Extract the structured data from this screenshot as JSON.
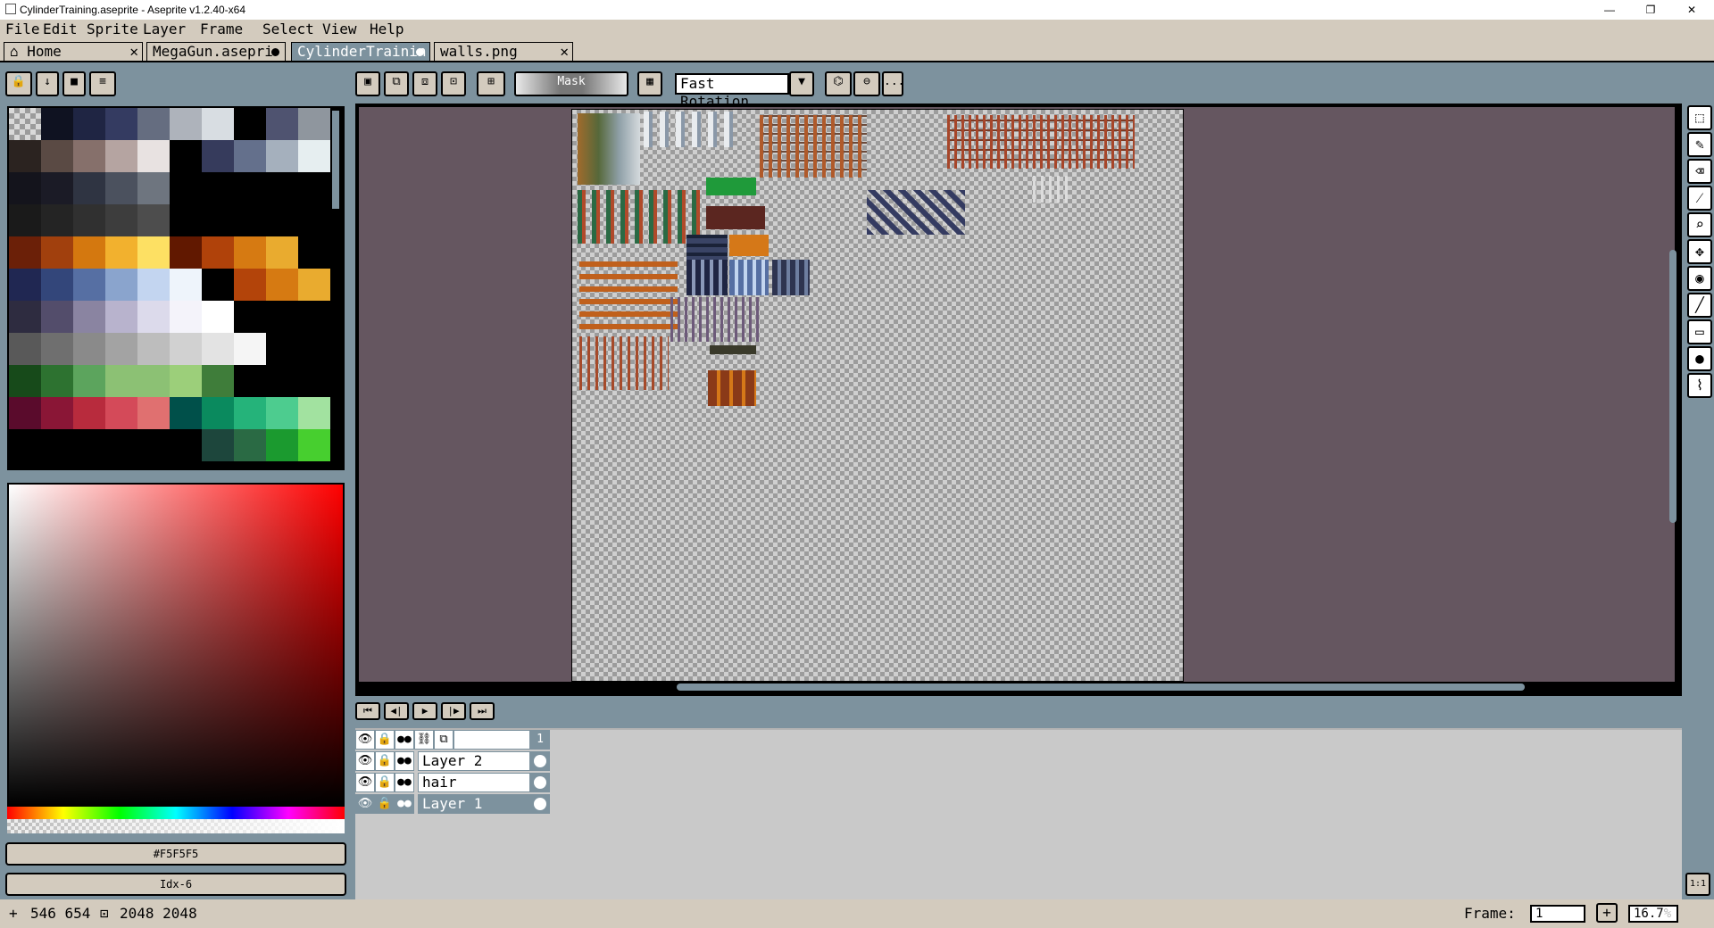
{
  "window": {
    "title": "CylinderTraining.aseprite - Aseprite v1.2.40-x64",
    "minimize": "—",
    "maximize": "❐",
    "close": "✕"
  },
  "menu": [
    "File",
    "Edit",
    "Sprite",
    "Layer",
    "Frame",
    "Select",
    "View",
    "Help"
  ],
  "tabs": [
    {
      "label": "Home",
      "marker": "✕"
    },
    {
      "label": "MegaGun.asepri",
      "marker": "dot"
    },
    {
      "label": "CylinderTrainin",
      "marker": "dot"
    },
    {
      "label": "walls.png",
      "marker": "✕"
    }
  ],
  "context_bar": {
    "mask_label": "Mask",
    "rotation_algorithm": "Fast Rotation",
    "more": "..."
  },
  "palette": {
    "rows": [
      [
        "checker",
        "#0f1221",
        "#1f2543",
        "#343b61",
        "#656d80",
        "#aeb3bb",
        "#d8dde2",
        "#000000",
        "#4f5370",
        "#8f969e"
      ],
      [
        "#2b2320",
        "#5a4a44",
        "#86706b",
        "#b5a4a1",
        "#e8e2e1",
        "#000000",
        "#363b5c",
        "#64708c",
        "#a5b0bd",
        "#e6eef0"
      ],
      [
        "#14141c",
        "#1b1b26",
        "#2f3442",
        "#4b515e",
        "#6e757f",
        "#000000",
        "#000000",
        "#000000",
        "#000000",
        "#000000"
      ],
      [
        "#1a1a1a",
        "#242424",
        "#303030",
        "#3d3d3d",
        "#4d4d4d",
        "#000000",
        "#000000",
        "#000000",
        "#000000",
        "#000000"
      ],
      [
        "#6b2008",
        "#a1400d",
        "#d4780f",
        "#f2b12e",
        "#fde063",
        "#611800",
        "#b0420a",
        "#d67a12",
        "#e9ab2f",
        "#000000"
      ],
      [
        "#202752",
        "#33467a",
        "#566fa3",
        "#8aa4cd",
        "#c3d5f0",
        "#eef4fb",
        "#000000",
        "#b3440a",
        "#d67a12",
        "#e9ab2f"
      ],
      [
        "#2e2c40",
        "#534d6b",
        "#8a84a1",
        "#b8b3cd",
        "#dcdaeb",
        "#f4f3fa",
        "#ffffff",
        "#000000",
        "#000000",
        "#000000"
      ],
      [
        "#595959",
        "#6f6f6f",
        "#8a8a8a",
        "#a3a3a3",
        "#bdbdbd",
        "#d1d1d1",
        "#e3e3e3",
        "#f5f5f5",
        "#000000",
        "#000000"
      ],
      [
        "#174a1a",
        "#2d7230",
        "#5ca45d",
        "#8cc174",
        "#8cc174",
        "#9ccf7a",
        "#3f7d3a",
        "#000000",
        "#000000",
        "#000000"
      ],
      [
        "#5a0b2c",
        "#8a1636",
        "#b82b3d",
        "#d44a59",
        "#e07070",
        "#00504a",
        "#0a8a5e",
        "#25b37a",
        "#4dcc8f",
        "#a2e2a0"
      ],
      [
        "#000000",
        "#000000",
        "#000000",
        "#000000",
        "#000000",
        "#000000",
        "#1d463c",
        "#2a6a44",
        "#1b9a2f",
        "#47cf2f"
      ]
    ]
  },
  "color_fields": {
    "hex": "#F5F5F5",
    "index": "Idx-6"
  },
  "colors": {
    "ui_bg": "#7d929e",
    "panel": "#d3cbbe",
    "canvas_bg": "#655660",
    "accent_selected": "#7d929e"
  },
  "tools": [
    "rectangular-marquee",
    "pencil",
    "eraser",
    "eyedropper",
    "zoom",
    "move",
    "paint-bucket",
    "line",
    "rectangle",
    "contour",
    "blur"
  ],
  "timeline": {
    "frame_number": "1",
    "layers": [
      {
        "name": "Layer 2",
        "selected": false
      },
      {
        "name": "hair",
        "selected": false
      },
      {
        "name": "Layer 1",
        "selected": true
      }
    ]
  },
  "status": {
    "cursor_pos": "546 654",
    "sprite_size": "2048 2048",
    "frame_label": "Frame:",
    "frame_value": "1",
    "zoom_value": "16.7",
    "zoom_unit": "%",
    "zoom_reset": "1:1",
    "add_frame": "+"
  }
}
